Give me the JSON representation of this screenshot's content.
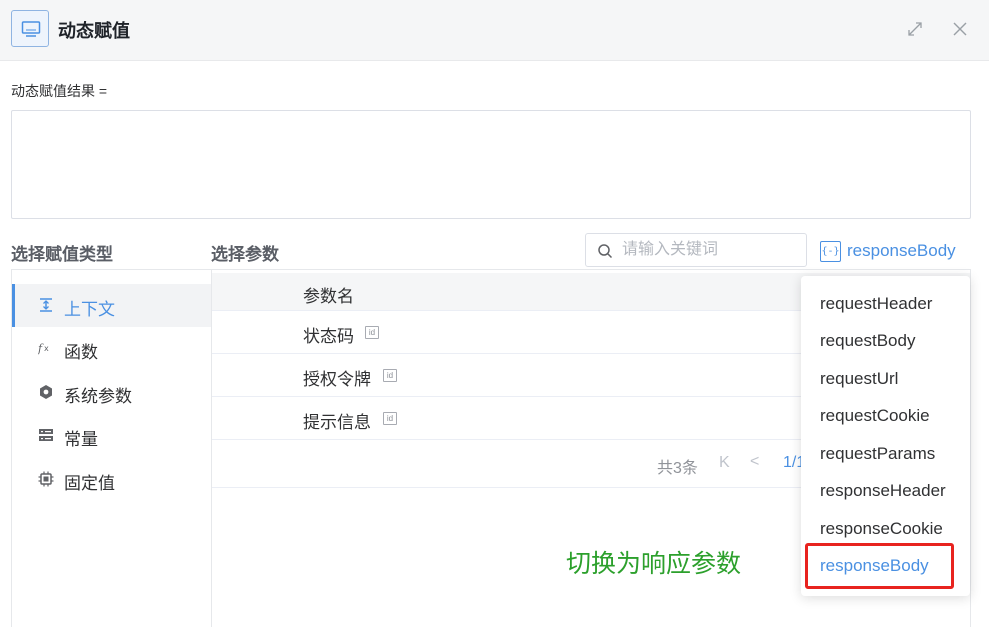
{
  "dialog": {
    "title": "动态赋值"
  },
  "result": {
    "label": "动态赋值结果 =",
    "value": ""
  },
  "sections": {
    "type_heading": "选择赋值类型",
    "param_heading": "选择参数"
  },
  "search": {
    "placeholder": "请输入关键词",
    "value": ""
  },
  "source_selector": {
    "icon": "{-}",
    "label": "responseBody"
  },
  "types": [
    {
      "label": "上下文",
      "icon": "context-icon",
      "active": true
    },
    {
      "label": "函数",
      "icon": "function-icon",
      "active": false
    },
    {
      "label": "系统参数",
      "icon": "system-hexagon-icon",
      "active": false
    },
    {
      "label": "常量",
      "icon": "constant-icon",
      "active": false
    },
    {
      "label": "固定值",
      "icon": "chip-icon",
      "active": false
    }
  ],
  "table": {
    "column_header": "参数名",
    "rows": [
      {
        "name": "状态码",
        "badge": "id"
      },
      {
        "name": "授权令牌",
        "badge": "id"
      },
      {
        "name": "提示信息",
        "badge": "id"
      }
    ]
  },
  "pagination": {
    "total": "共3条",
    "first": "K",
    "prev": "<",
    "page": "1/1"
  },
  "dropdown": {
    "items": [
      "requestHeader",
      "requestBody",
      "requestUrl",
      "requestCookie",
      "requestParams",
      "responseHeader",
      "responseCookie",
      "responseBody"
    ],
    "selected": "responseBody"
  },
  "annotation": {
    "text": "切换为响应参数"
  },
  "colors": {
    "accent": "#4a90e2",
    "annotation_green": "#2ca02c",
    "highlight_red": "#e8231f"
  }
}
